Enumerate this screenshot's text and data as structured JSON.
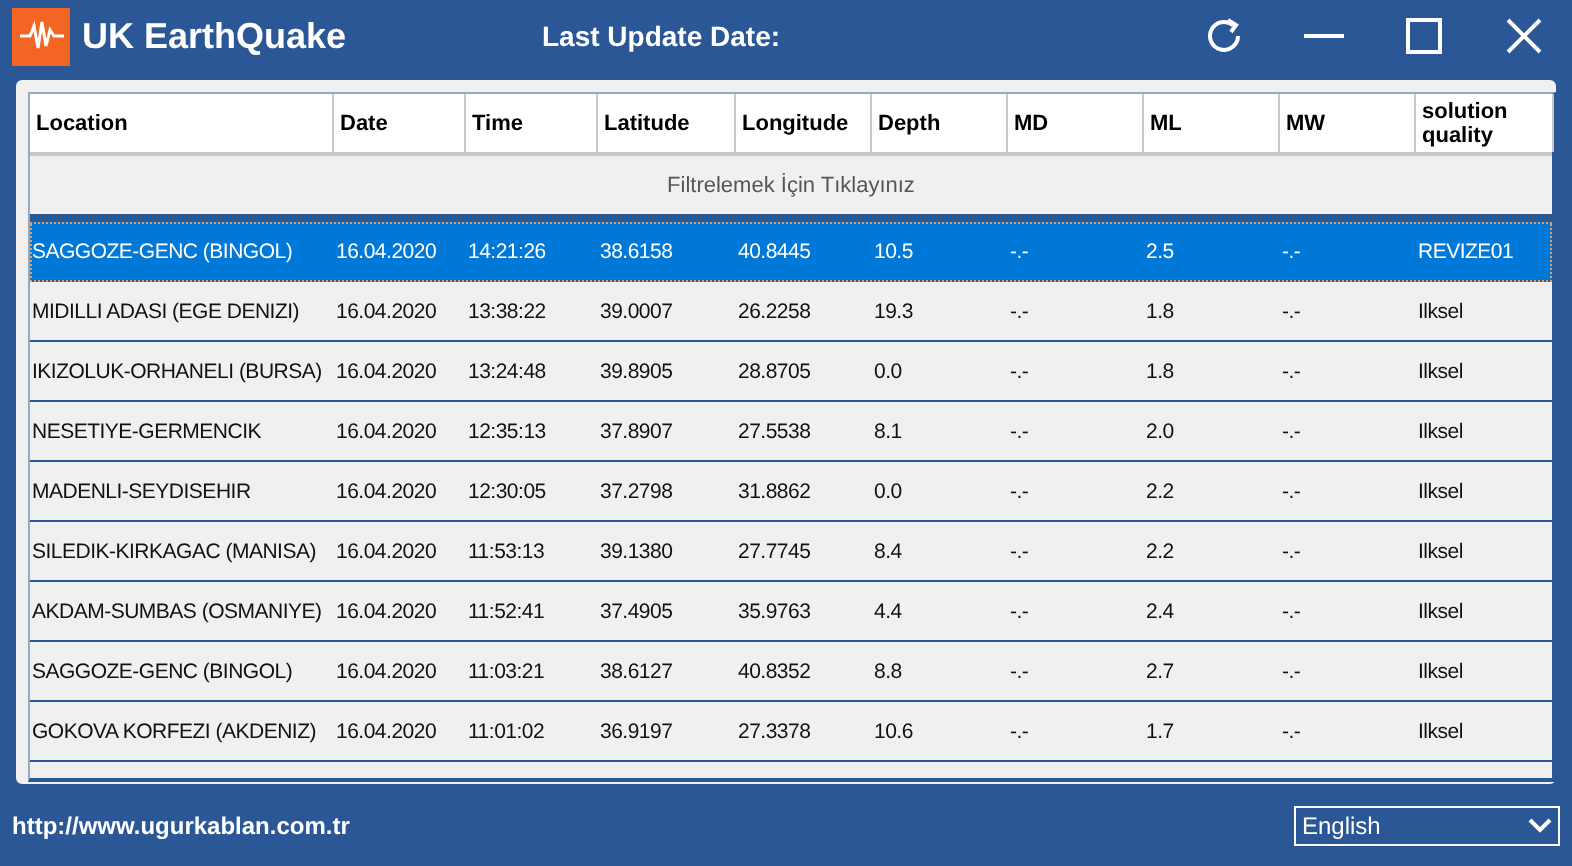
{
  "window": {
    "title": "UK EarthQuake",
    "last_update_label": "Last Update Date:"
  },
  "table": {
    "columns": [
      "Location",
      "Date",
      "Time",
      "Latitude",
      "Longitude",
      "Depth",
      "MD",
      "ML",
      "MW",
      "solution quality"
    ],
    "filter_hint": "Filtrelemek İçin Tıklayınız",
    "rows": [
      {
        "selected": true,
        "cells": [
          "SAGGOZE-GENC (BINGOL)",
          "16.04.2020",
          "14:21:26",
          "38.6158",
          "40.8445",
          "10.5",
          "-.-",
          "2.5",
          "-.-",
          "REVIZE01"
        ]
      },
      {
        "selected": false,
        "cells": [
          "MIDILLI ADASI (EGE DENIZI)",
          "16.04.2020",
          "13:38:22",
          "39.0007",
          "26.2258",
          "19.3",
          "-.-",
          "1.8",
          "-.-",
          "Ilksel"
        ]
      },
      {
        "selected": false,
        "cells": [
          "IKIZOLUK-ORHANELI (BURSA)",
          "16.04.2020",
          "13:24:48",
          "39.8905",
          "28.8705",
          "0.0",
          "-.-",
          "1.8",
          "-.-",
          "Ilksel"
        ]
      },
      {
        "selected": false,
        "cells": [
          "NESETIYE-GERMENCIK",
          "16.04.2020",
          "12:35:13",
          "37.8907",
          "27.5538",
          "8.1",
          "-.-",
          "2.0",
          "-.-",
          "Ilksel"
        ]
      },
      {
        "selected": false,
        "cells": [
          "MADENLI-SEYDISEHIR",
          "16.04.2020",
          "12:30:05",
          "37.2798",
          "31.8862",
          "0.0",
          "-.-",
          "2.2",
          "-.-",
          "Ilksel"
        ]
      },
      {
        "selected": false,
        "cells": [
          "SILEDIK-KIRKAGAC (MANISA)",
          "16.04.2020",
          "11:53:13",
          "39.1380",
          "27.7745",
          "8.4",
          "-.-",
          "2.2",
          "-.-",
          "Ilksel"
        ]
      },
      {
        "selected": false,
        "cells": [
          "AKDAM-SUMBAS (OSMANIYE)",
          "16.04.2020",
          "11:52:41",
          "37.4905",
          "35.9763",
          "4.4",
          "-.-",
          "2.4",
          "-.-",
          "Ilksel"
        ]
      },
      {
        "selected": false,
        "cells": [
          "SAGGOZE-GENC (BINGOL)",
          "16.04.2020",
          "11:03:21",
          "38.6127",
          "40.8352",
          "8.8",
          "-.-",
          "2.7",
          "-.-",
          "Ilksel"
        ]
      },
      {
        "selected": false,
        "cells": [
          "GOKOVA KORFEZI (AKDENIZ)",
          "16.04.2020",
          "11:01:02",
          "36.9197",
          "27.3378",
          "10.6",
          "-.-",
          "1.7",
          "-.-",
          "Ilksel"
        ]
      }
    ]
  },
  "status_bar": {
    "link": "http://www.ugurkablan.com.tr",
    "language": "English"
  }
}
